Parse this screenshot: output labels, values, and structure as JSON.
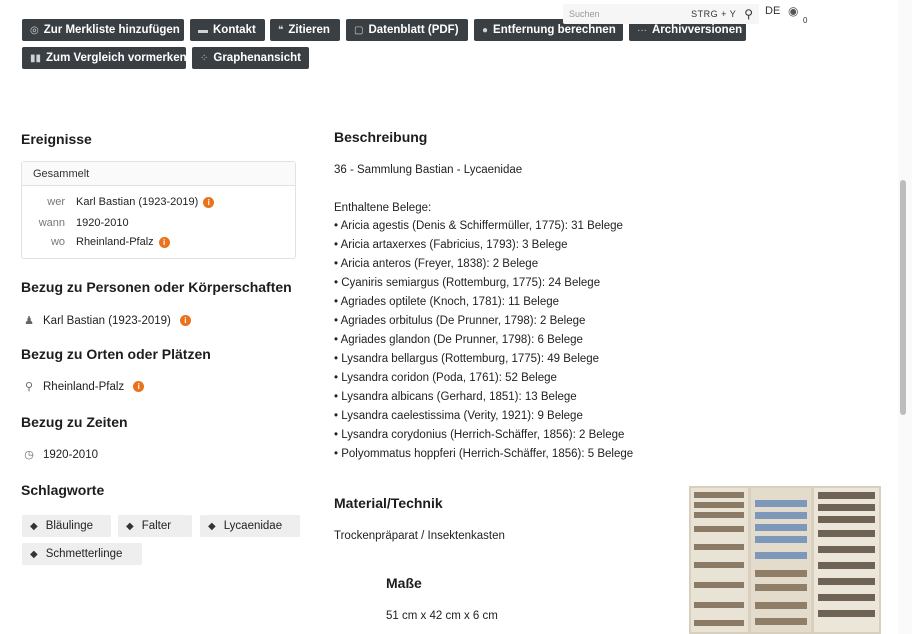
{
  "toolbar": {
    "row1": [
      {
        "icon": "eye-icon",
        "label": "Zur Merkliste hinzufügen"
      },
      {
        "icon": "contact-icon",
        "label": "Kontakt"
      },
      {
        "icon": "quote-icon",
        "label": "Zitieren"
      },
      {
        "icon": "document-icon",
        "label": "Datenblatt (PDF)"
      },
      {
        "icon": "location-icon",
        "label": "Entfernung berechnen"
      },
      {
        "icon": "ellipsis-icon",
        "label": "Archivversionen"
      }
    ],
    "row2": [
      {
        "icon": "compare-icon",
        "label": "Zum Vergleich vormerken"
      },
      {
        "icon": "graph-icon",
        "label": "Graphenansicht"
      }
    ]
  },
  "search": {
    "placeholder": "Suchen",
    "shortcut": "STRG + Y"
  },
  "lang": "DE",
  "eye_count": "0",
  "left": {
    "ereignisse_title": "Ereignisse",
    "event_card": {
      "header": "Gesammelt",
      "rows": [
        {
          "key": "wer",
          "value": "Karl Bastian (1923-2019)",
          "info": true
        },
        {
          "key": "wann",
          "value": "1920-2010",
          "info": false
        },
        {
          "key": "wo",
          "value": "Rheinland-Pfalz",
          "info": true
        }
      ]
    },
    "personen_title": "Bezug zu Personen oder Körperschaften",
    "personen_value": "Karl Bastian (1923-2019)",
    "orte_title": "Bezug zu Orten oder Plätzen",
    "orte_value": "Rheinland-Pfalz",
    "zeiten_title": "Bezug zu Zeiten",
    "zeiten_value": "1920-2010",
    "schlagworte_title": "Schlagworte",
    "tags": [
      "Bläulinge",
      "Falter",
      "Lycaenidae",
      "Schmetterlinge"
    ]
  },
  "right": {
    "beschreibung_title": "Beschreibung",
    "beschreibung_intro": "36 - Sammlung Bastian - Lycaenidae",
    "belege_title": "Enthaltene Belege:",
    "belege": [
      "• Aricia agestis (Denis & Schiffermüller, 1775): 31 Belege",
      "• Aricia artaxerxes (Fabricius, 1793): 3 Belege",
      "• Aricia anteros (Freyer, 1838): 2 Belege",
      "• Cyaniris semiargus (Rottemburg, 1775): 24 Belege",
      "• Agriades optilete (Knoch, 1781): 11 Belege",
      "• Agriades orbitulus (De Prunner, 1798): 2 Belege",
      "• Agriades glandon (De Prunner, 1798): 6 Belege",
      "• Lysandra bellargus (Rottemburg, 1775): 49 Belege",
      "• Lysandra coridon (Poda, 1761): 52 Belege",
      "• Lysandra albicans (Gerhard, 1851): 13 Belege",
      "• Lysandra caelestissima (Verity, 1921): 9 Belege",
      "• Lysandra corydonius (Herrich-Schäffer, 1856): 2 Belege",
      "• Polyommatus hoppferi (Herrich-Schäffer, 1856): 5 Belege"
    ],
    "material_title": "Material/Technik",
    "material_value": "Trockenpräparat / Insektenkasten",
    "masse_title": "Maße",
    "masse_value": "51 cm x 42 cm x 6 cm"
  },
  "colors": {
    "button_bg": "#3a3f44",
    "info_orange": "#e8731c",
    "tag_bg": "#eeeeee"
  }
}
